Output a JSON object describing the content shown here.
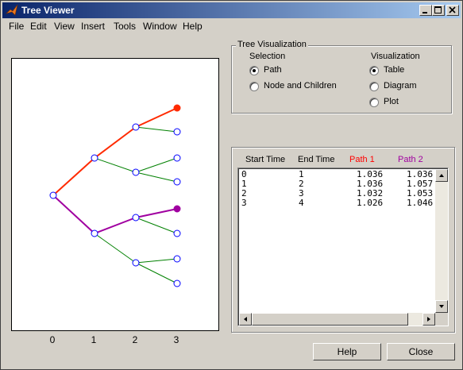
{
  "window": {
    "title": "Tree Viewer"
  },
  "menu": [
    "File",
    "Edit",
    "View",
    "Insert",
    "Tools",
    "Window",
    "Help"
  ],
  "tree_plot": {
    "x_ticks": [
      "0",
      "1",
      "2",
      "3"
    ],
    "path1_color": "#ff2a00",
    "path2_color": "#a000a0",
    "edge_color": "#008000",
    "node_color": "#0000ff"
  },
  "tree_visualization": {
    "title": "Tree Visualization",
    "selection": {
      "title": "Selection",
      "options": [
        {
          "label": "Path",
          "selected": true
        },
        {
          "label": "Node and Children",
          "selected": false
        }
      ]
    },
    "visualization": {
      "title": "Visualization",
      "options": [
        {
          "label": "Table",
          "selected": true
        },
        {
          "label": "Diagram",
          "selected": false
        },
        {
          "label": "Plot",
          "selected": false
        }
      ]
    }
  },
  "table": {
    "headers": [
      "Start Time",
      "End Time",
      "Path 1",
      "Path 2"
    ],
    "header_colors": [
      "#000000",
      "#000000",
      "#ff0000",
      "#a000a0"
    ],
    "rows": [
      [
        "0",
        "1",
        "1.036",
        "1.036"
      ],
      [
        "1",
        "2",
        "1.036",
        "1.057"
      ],
      [
        "2",
        "3",
        "1.032",
        "1.053"
      ],
      [
        "3",
        "4",
        "1.026",
        "1.046"
      ]
    ]
  },
  "buttons": {
    "help": "Help",
    "close": "Close"
  }
}
